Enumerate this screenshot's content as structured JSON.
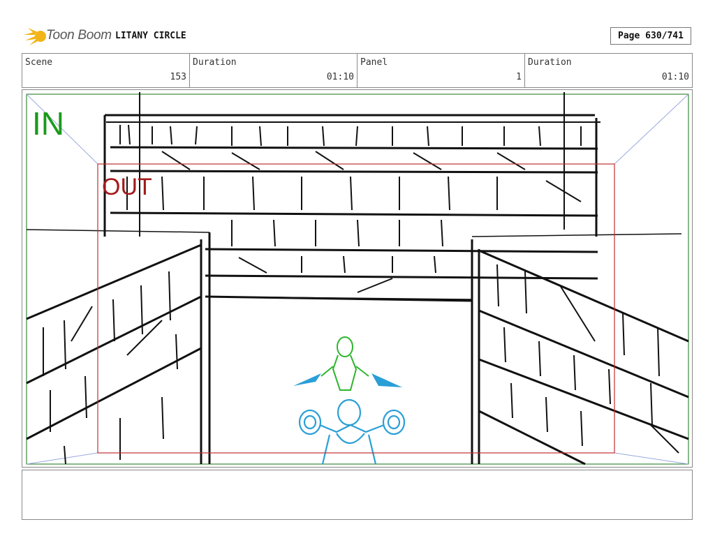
{
  "header": {
    "brand": "Toon Boom",
    "project_title": "LITANY CIRCLE",
    "page": "Page 630/741"
  },
  "info": {
    "scene_label": "Scene",
    "scene_value": "153",
    "duration_label": "Duration",
    "duration_value": "01:10",
    "panel_label": "Panel",
    "panel_value": "1",
    "panel_duration_label": "Duration",
    "panel_duration_value": "01:10"
  },
  "frame": {
    "in_label": "IN",
    "out_label": "OUT",
    "in_color": "#1a9a1a",
    "out_color": "#a31a1a",
    "figure_front_color": "#2a9fd6",
    "figure_back_color": "#2db52d"
  },
  "icons": {
    "logo": "toon-boom-logo-icon"
  }
}
